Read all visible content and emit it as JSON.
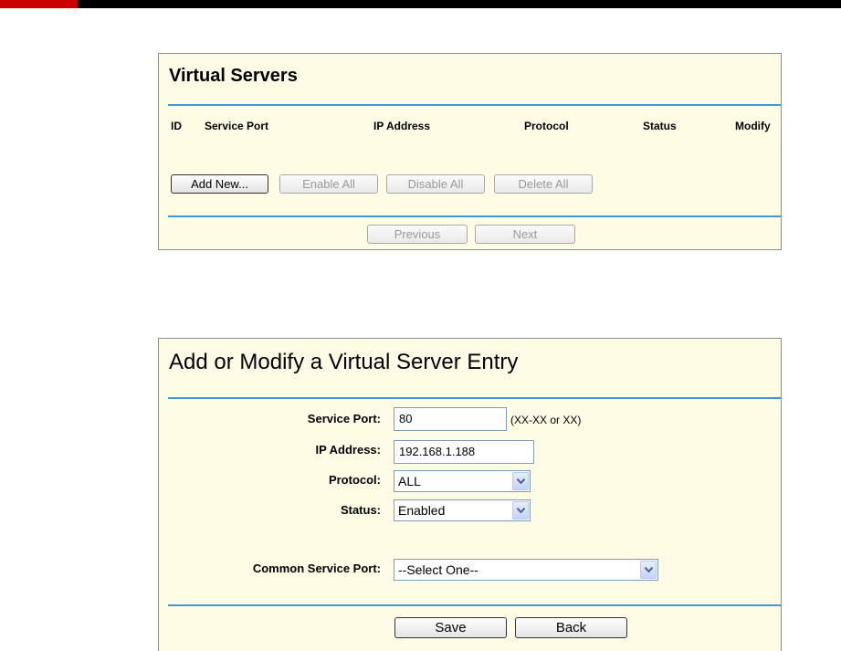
{
  "virtual_servers": {
    "title": "Virtual Servers",
    "columns": [
      "ID",
      "Service Port",
      "IP Address",
      "Protocol",
      "Status",
      "Modify"
    ],
    "buttons": {
      "add_new": "Add New...",
      "enable_all": "Enable All",
      "disable_all": "Disable All",
      "delete_all": "Delete All",
      "previous": "Previous",
      "next": "Next"
    }
  },
  "entry_form": {
    "title": "Add or Modify a Virtual Server Entry",
    "service_port": {
      "label": "Service Port:",
      "value": "80",
      "hint": "(XX-XX or XX)"
    },
    "ip_address": {
      "label": "IP Address:",
      "value": "192.168.1.188"
    },
    "protocol": {
      "label": "Protocol:",
      "value": "ALL"
    },
    "status": {
      "label": "Status:",
      "value": "Enabled"
    },
    "common_service_port": {
      "label": "Common Service Port:",
      "value": "--Select One--"
    },
    "buttons": {
      "save": "Save",
      "back": "Back"
    }
  },
  "colors": {
    "accent_bar": "#cc0000",
    "separator": "#3a99d6",
    "panel_bg": "#fffce6"
  }
}
